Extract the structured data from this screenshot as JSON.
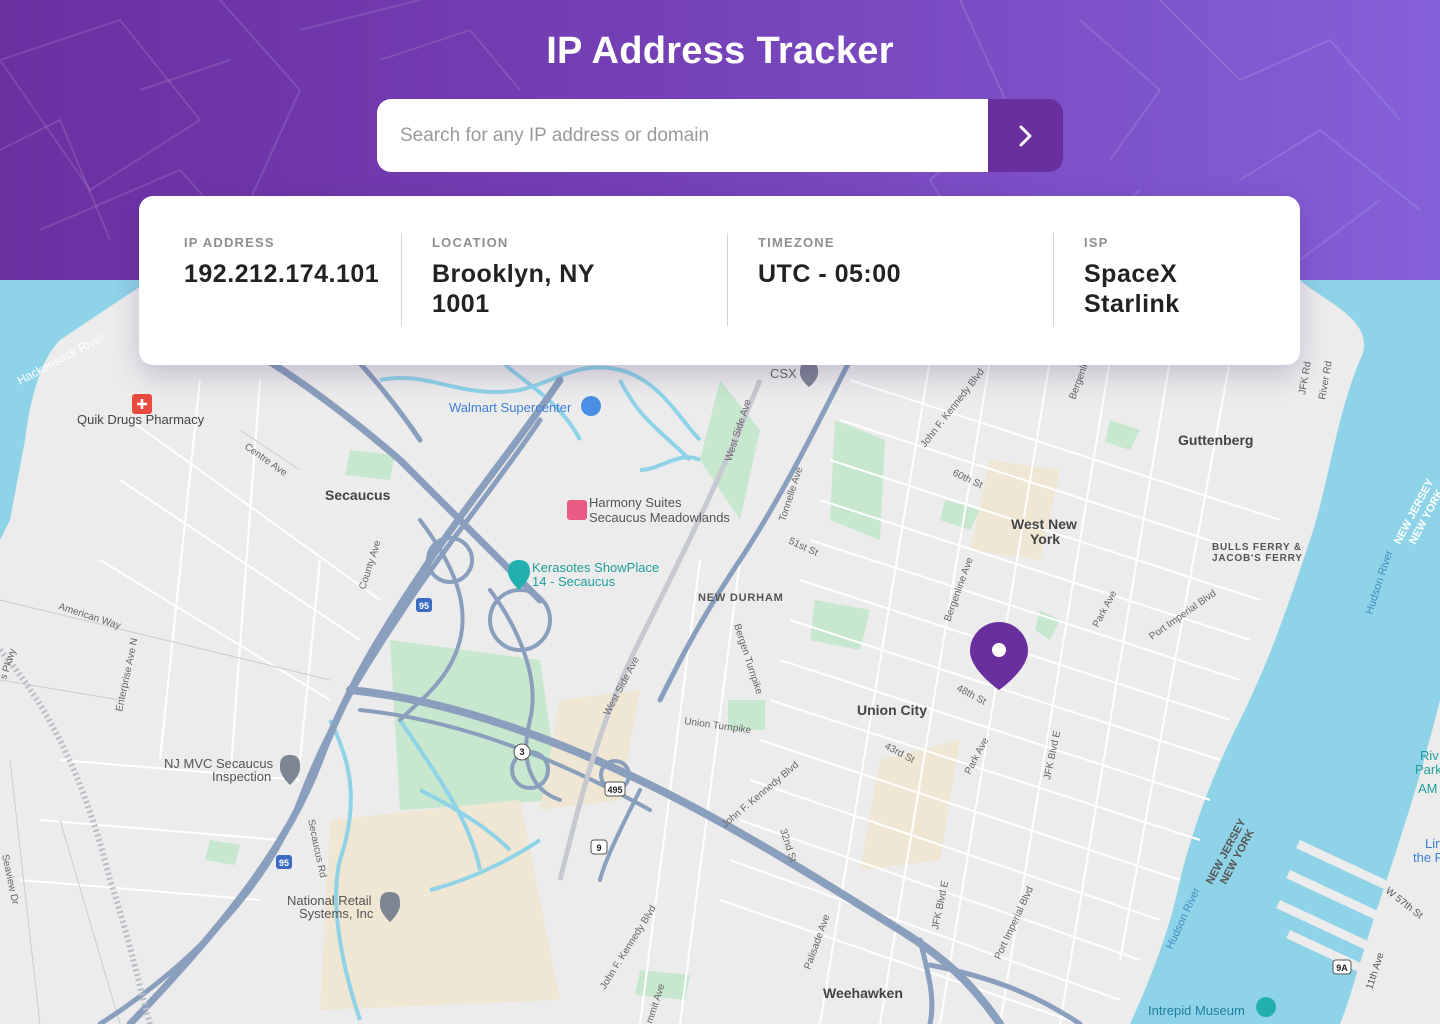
{
  "header": {
    "title": "IP Address Tracker",
    "background_start": "#6b2fa0",
    "background_end": "#8460d8"
  },
  "search": {
    "placeholder": "Search for any IP address or domain",
    "value": "",
    "button_icon": "chevron-right-icon",
    "button_color": "#6a2f9e"
  },
  "info": {
    "ip": {
      "label": "IP ADDRESS",
      "value": "192.212.174.101"
    },
    "location": {
      "label": "LOCATION",
      "value_line1": "Brooklyn, NY",
      "value_line2": "1001"
    },
    "timezone": {
      "label": "TIMEZONE",
      "value": "UTC - 05:00"
    },
    "isp": {
      "label": "ISP",
      "value_line1": "SpaceX",
      "value_line2": "Starlink"
    }
  },
  "map": {
    "marker_icon": "location-pin-icon",
    "marker_color": "#6a2f9e",
    "water_color": "#8fd3e8",
    "road_color": "#8a9fbd",
    "labels": {
      "hackensack_river": "Hackensack River",
      "quik_drugs": "Quik Drugs Pharmacy",
      "walmart": "Walmart Supercenter",
      "csx": "CSX",
      "jfk_blvd_north": "John F. Kennedy Blvd",
      "bergenline_north": "Bergenline Ave",
      "jfk_rd": "JFK Rd",
      "river_rd": "River Rd",
      "guttenberg": "Guttenberg",
      "centre_ave": "Centre Ave",
      "secaucus": "Secaucus",
      "harmony_1": "Harmony Suites",
      "harmony_2": "Secaucus Meadowlands",
      "west_side_ave_north": "West Side Ave",
      "tonnelle_ave": "Tonnelle Ave",
      "st_60th": "60th St",
      "west_new_york_1": "West New",
      "west_new_york_2": "York",
      "bulls_ferry_1": "BULLS FERRY &",
      "bulls_ferry_2": "JACOB'S FERRY",
      "nj_ny_north_1": "NEW JERSEY",
      "nj_ny_north_2": "NEW YORK",
      "kerasotes_1": "Kerasotes ShowPlace",
      "kerasotes_2": "14 - Secaucus",
      "st_51st": "51st St",
      "county_ave": "County Ave",
      "new_durham": "NEW DURHAM",
      "bergenline_ave": "Bergenline Ave",
      "park_ave_north": "Park Ave",
      "port_imperial_north": "Port Imperial Blvd",
      "hudson_river_north": "Hudson River",
      "american_way": "American Way",
      "bergen_turnpike": "Bergen Turnpike",
      "st_48th": "48th St",
      "union_city": "Union City",
      "enterprise_ave": "Enterprise Ave N",
      "west_side_ave": "West Side Ave",
      "union_turnpike": "Union Turnpike",
      "parkway": "s Pkwy",
      "st_43rd": "43rd St",
      "park_ave": "Park Ave",
      "jfk_blvd_e": "JFK Blvd E",
      "nj_mvc_1": "NJ MVC Secaucus",
      "nj_mvc_2": "Inspection",
      "jfk_blvd_south": "John F. Kennedy Blvd",
      "riv_park_1": "Riv",
      "riv_park_2": "Park",
      "riv_park_3": "AM",
      "nj_ny_south_1": "NEW JERSEY",
      "nj_ny_south_2": "NEW YORK",
      "secaucus_rd": "Secaucus Rd",
      "st_32nd": "32nd St",
      "lin_1": "Lin",
      "lin_2": "the F",
      "seaview_dr": "Seaview Dr",
      "jfk_blvd_e_south": "JFK Blvd E",
      "port_imperial_south": "Port Imperial Blvd",
      "hudson_river_south": "Hudson River",
      "w_57th": "W 57th St",
      "national_retail_1": "National Retail",
      "national_retail_2": "Systems, Inc",
      "palisade_ave": "Palisade Ave",
      "jfk_blvd_sw": "John F. Kennedy Blvd",
      "ave_11th": "11th Ave",
      "weehawken": "Weehawken",
      "summit_ave": "mmit Ave",
      "intrepid": "Intrepid Museum",
      "shield_95_north": "95",
      "shield_3": "3",
      "shield_495": "495",
      "shield_9": "9",
      "shield_95_south": "95",
      "shield_9a": "9A"
    }
  }
}
